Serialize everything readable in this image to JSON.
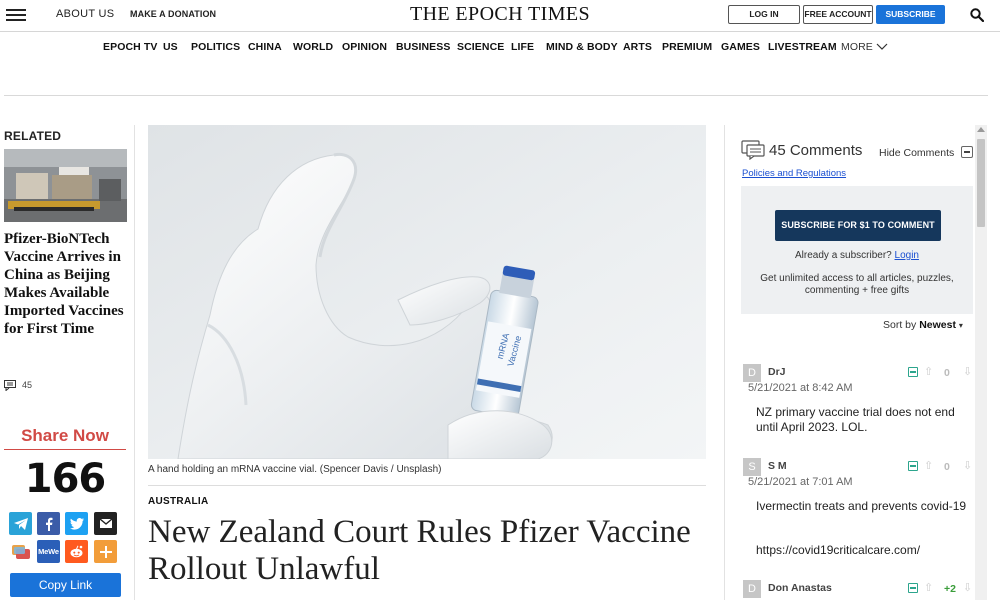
{
  "header": {
    "about": "ABOUT US",
    "donate": "MAKE A DONATION",
    "masthead": "THE EPOCH TIMES",
    "login": "LOG IN",
    "free_account": "FREE ACCOUNT",
    "subscribe": "SUBSCRIBE"
  },
  "nav": {
    "items": [
      "EPOCH TV",
      "US",
      "POLITICS",
      "CHINA",
      "WORLD",
      "OPINION",
      "BUSINESS",
      "SCIENCE",
      "LIFE",
      "MIND & BODY",
      "ARTS",
      "PREMIUM",
      "GAMES",
      "LIVESTREAM"
    ],
    "more": "MORE"
  },
  "related": {
    "title": "RELATED",
    "headline": "Pfizer-BioNTech Vaccine Arrives in China as Beijing Makes Available Imported Vaccines for First Time",
    "comment_count": "45"
  },
  "share": {
    "title": "Share Now",
    "count": "166",
    "copy_link": "Copy Link",
    "mewe_label": "MeWe"
  },
  "article": {
    "caption": "A hand holding an mRNA vaccine vial. (Spencer Davis / Unsplash)",
    "section": "AUSTRALIA",
    "title": "New Zealand Court Rules Pfizer Vaccine Rollout Unlawful"
  },
  "comments": {
    "count_label": "45 Comments",
    "hide": "Hide Comments",
    "policies": "Policies and Regulations",
    "subscribe_btn": "SUBSCRIBE FOR $1 TO COMMENT",
    "already": "Already a subscriber?",
    "login_link": "Login",
    "access": "Get unlimited access to all articles, puzzles, commenting + free gifts",
    "sort_label": "Sort by",
    "sort_value": "Newest",
    "items": [
      {
        "initial": "D",
        "author": "DrJ",
        "date": "5/21/2021 at 8:42 AM",
        "score": "0",
        "text": "NZ primary vaccine trial does not end until April 2023. LOL.",
        "text2": ""
      },
      {
        "initial": "S",
        "author": "S M",
        "date": "5/21/2021 at 7:01 AM",
        "score": "0",
        "text": "Ivermectin treats and prevents covid-19",
        "text2": "https://covid19criticalcare.com/"
      },
      {
        "initial": "D",
        "author": "Don Anastas",
        "date": "",
        "score": "+2",
        "text": "",
        "text2": ""
      }
    ]
  },
  "colors": {
    "accent_blue": "#1a73d9",
    "subscribe_navy": "#15375c",
    "share_red": "#d14a45",
    "positive_green": "#3a9d3a",
    "telegram": "#2aa3d8",
    "facebook": "#3b5ca8",
    "twitter": "#1da1f2",
    "email": "#222222",
    "reddit": "#ff5a1f",
    "add": "#f29d3a"
  },
  "icons": [
    "menu-icon",
    "search-icon",
    "chevron-down-icon",
    "comment-bubble-icon",
    "telegram-icon",
    "facebook-icon",
    "twitter-icon",
    "email-icon",
    "parler-icon",
    "mewe-icon",
    "reddit-icon",
    "add-icon"
  ]
}
